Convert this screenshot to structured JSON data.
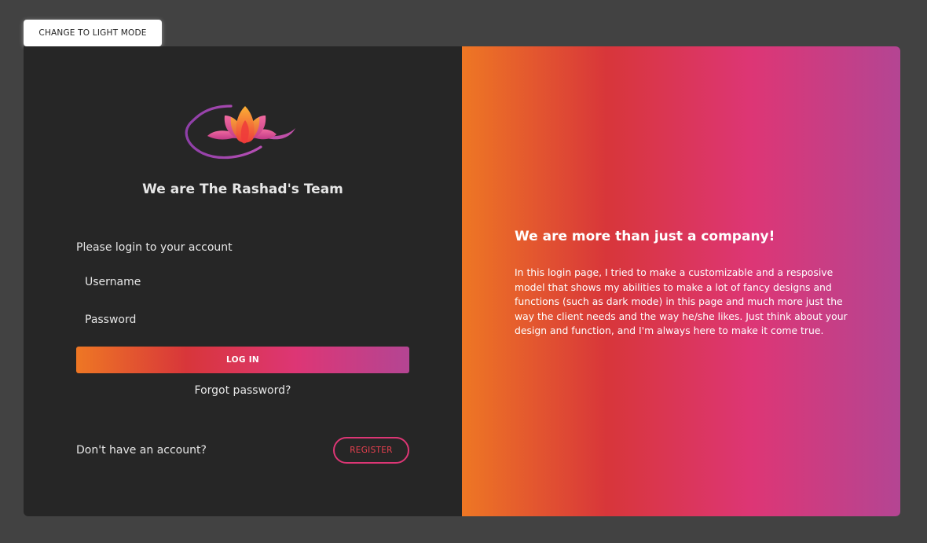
{
  "toolbar": {
    "mode_toggle_label": "CHANGE TO LIGHT MODE"
  },
  "login_panel": {
    "logo_icon": "lotus-logo-icon",
    "team_title": "We are The Rashad's Team",
    "prompt": "Please login to your account",
    "username_placeholder": "Username",
    "password_placeholder": "Password",
    "login_label": "LOG IN",
    "forgot_label": "Forgot password?",
    "no_account_text": "Don't have an account?",
    "register_label": "REGISTER"
  },
  "info_panel": {
    "headline": "We are more than just a company!",
    "description": "In this login page, I tried to make a customizable and a resposive model that shows my abilities to make a lot of fancy designs and functions (such as dark mode) in this page and much more just the way the client needs and the way he/she likes. Just think about your design and function, and I'm always here to make it come true."
  },
  "colors": {
    "page_background": "#424242",
    "panel_background": "#262626",
    "gradient": [
      "#ee7724",
      "#d8363a",
      "#dd3675",
      "#b44593"
    ],
    "register_text": "#e8404f"
  }
}
